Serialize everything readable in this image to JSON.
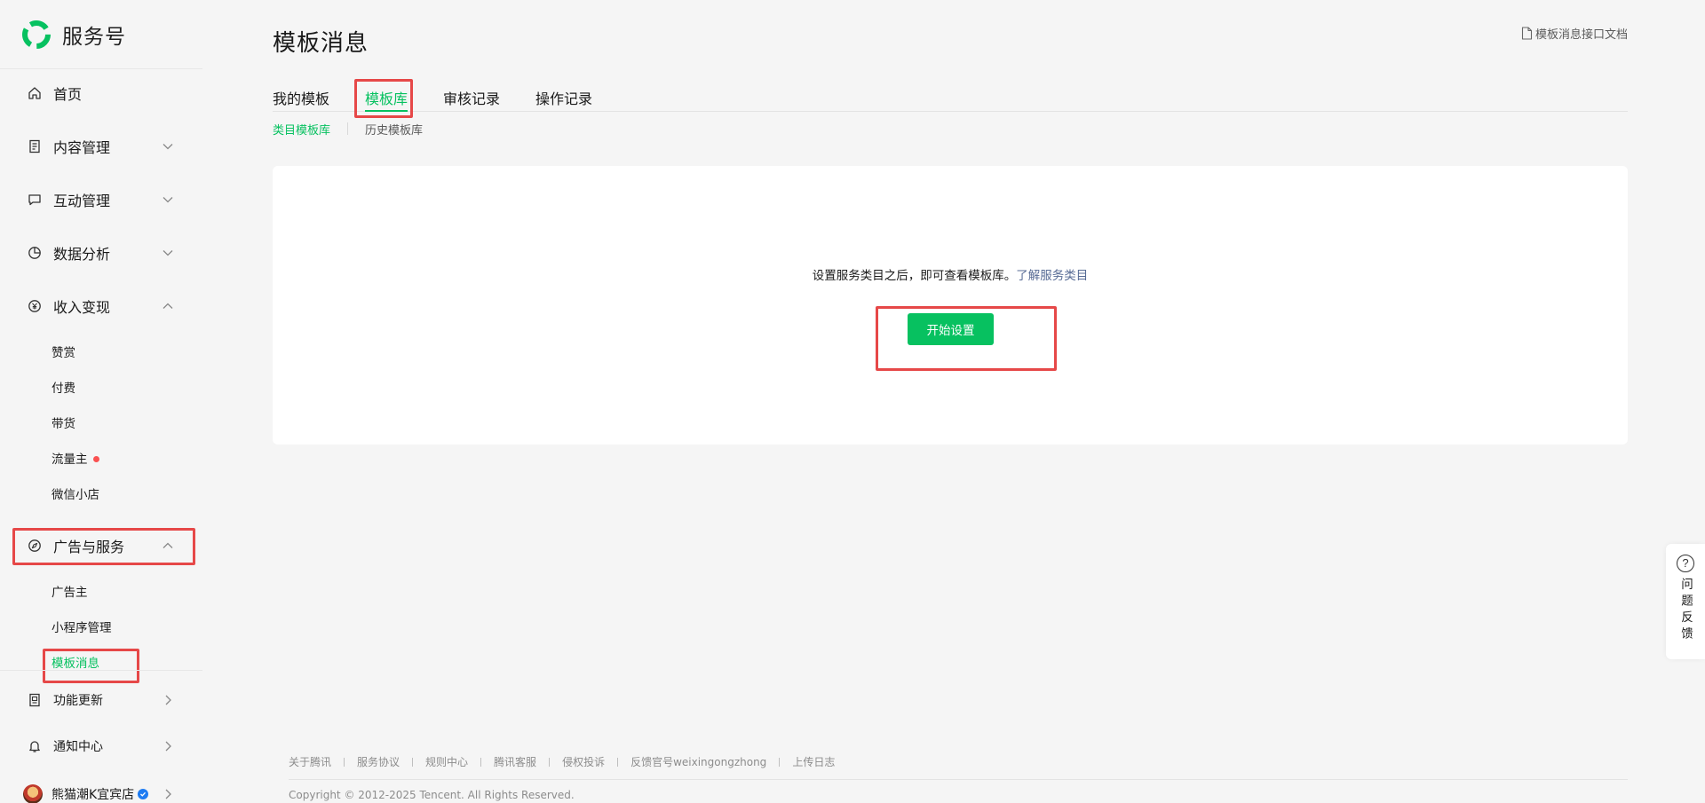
{
  "brand": {
    "name": "服务号",
    "logo": "wechat-service-logo"
  },
  "sidebar": {
    "home": "首页",
    "content_mgmt": "内容管理",
    "interaction_mgmt": "互动管理",
    "data_analysis": "数据分析",
    "monetization": {
      "label": "收入变现",
      "items": [
        "赞赏",
        "付费",
        "带货",
        "流量主",
        "微信小店"
      ]
    },
    "ads_services": {
      "label": "广告与服务",
      "items": [
        "广告主",
        "小程序管理",
        "模板消息"
      ]
    },
    "feature_updates": "功能更新",
    "notifications": "通知中心",
    "account_name": "熊猫潮K宜宾店"
  },
  "main": {
    "title": "模板消息",
    "doc_link": "模板消息接口文档",
    "tabs": [
      "我的模板",
      "模板库",
      "审核记录",
      "操作记录"
    ],
    "active_tab": "模板库",
    "subtabs": [
      "类目模板库",
      "历史模板库"
    ],
    "empty_text": "设置服务类目之后，即可查看模板库。",
    "empty_link": "了解服务类目",
    "start_button": "开始设置"
  },
  "footer": {
    "links": [
      "关于腾讯",
      "服务协议",
      "规则中心",
      "腾讯客服",
      "侵权投诉",
      "反馈官号weixingongzhong",
      "上传日志"
    ],
    "copyright": "Copyright © 2012-2025 Tencent. All Rights Reserved."
  },
  "feedback": {
    "label": "问题反馈"
  },
  "colors": {
    "accent": "#07c160",
    "link": "#576b95",
    "highlight": "#e64848",
    "badge": "#fa5151"
  }
}
